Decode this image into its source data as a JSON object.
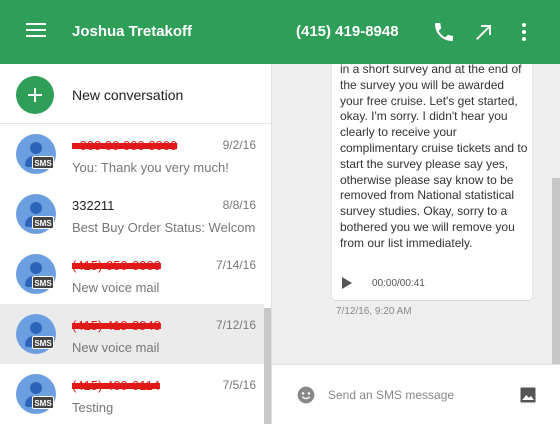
{
  "header": {
    "contact_name": "Joshua Tretakoff",
    "contact_phone": "(415) 419-8948",
    "icons": [
      "menu-icon",
      "phone-icon",
      "open-in-new-icon",
      "more-vert-icon"
    ]
  },
  "sidebar": {
    "new_conversation_label": "New conversation",
    "badge_label": "SMS",
    "conversations": [
      {
        "title": "+000 00 000 0000",
        "redacted": true,
        "date": "9/2/16",
        "snippet": "You: Thank you very much!"
      },
      {
        "title": "332211",
        "redacted": false,
        "date": "8/8/16",
        "snippet": "Best Buy Order Status: Welcome"
      },
      {
        "title": "(415) 050-0000",
        "redacted": true,
        "date": "7/14/16",
        "snippet": "New voice mail"
      },
      {
        "title": "(415) 419-8948",
        "redacted": true,
        "date": "7/12/16",
        "snippet": "New voice mail",
        "selected": true
      },
      {
        "title": "(415) 400-0114",
        "redacted": true,
        "date": "7/5/16",
        "snippet": "Testing"
      }
    ]
  },
  "thread": {
    "message_text": "in a short survey and at the end of the survey you will be awarded your free cruise. Let's get started, okay. I'm sorry. I didn't hear you clearly to receive your complimentary cruise tickets and to start the survey please say yes, otherwise please say know to be removed from National statistical survey studies. Okay, sorry to a bothered you we will remove you from our list immediately.",
    "audio_time": "00:00/00:41",
    "message_timestamp": "7/12/16, 9:20 AM"
  },
  "compose": {
    "placeholder": "Send an SMS message"
  },
  "colors": {
    "brand": "#2f9e58",
    "avatar": "#6b9fe0",
    "redaction": "#e01818"
  }
}
